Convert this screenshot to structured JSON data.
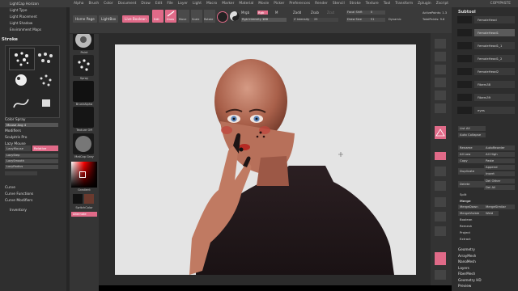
{
  "menubar": {
    "items": [
      "Alpha",
      "Brush",
      "Color",
      "Document",
      "Draw",
      "Edit",
      "File",
      "Layer",
      "Light",
      "Macro",
      "Marker",
      "Material",
      "Movie",
      "Picker",
      "Preferences",
      "Render",
      "Stencil",
      "Stroke",
      "Texture",
      "Tool",
      "Transform",
      "Zplugin",
      "Zscript"
    ],
    "left_items": [
      "LightCap Horizon",
      "Light Type",
      "Light Placement",
      "Light Shadow",
      "Environment Maps"
    ],
    "right_items": [
      "COPYPASTE"
    ]
  },
  "left_panel": {
    "section_title": "Stroke",
    "stroke_types": [
      "Spray",
      "Dots",
      "DragRect",
      "Spray",
      "Freehand",
      "Rect"
    ],
    "color_spray_label": "Color Spray",
    "mouse_avg_label": "Mouse Avg 4",
    "rows": [
      "Modifiers",
      "Sculptris Pro",
      "Lazy Mouse",
      "LazyMouse",
      "Relative",
      "Curve",
      "Curve Functions",
      "Curve Modifiers",
      "Inventory"
    ],
    "lazy_step_label": "LazyStep",
    "lazy_smooth_label": "LazySmooth",
    "lazy_radius_label": "LazyRadius"
  },
  "top_toolbar": {
    "home_page": "Home Page",
    "lightbox": "LightBox",
    "live_boolean": "Live Boolean",
    "edit": "Edit",
    "draw": "Draw",
    "move": "Move",
    "scale": "Scale",
    "rotate": "Rotate",
    "mrgb": "Mrgb",
    "rgb": "Rgb",
    "m": "M",
    "zadd": "Zadd",
    "zsub": "Zsub",
    "zcut": "Zcut",
    "rgb_intensity_label": "Rgb Intensity",
    "rgb_intensity_value": "100",
    "z_intensity_label": "Z Intensity",
    "z_intensity_value": "25",
    "focal_shift_label": "Focal Shift",
    "focal_shift_value": "0",
    "draw_size_label": "Draw Size",
    "draw_size_value": "51",
    "dynamic_label": "Dynamic",
    "active_points_label": "ActivePoints:",
    "active_points_value": "1.3",
    "total_points_label": "TotalPoints:",
    "total_points_value": "9.6"
  },
  "shelf": {
    "items": [
      "Paint",
      "Spray",
      "BrushAlpha",
      "Texture Off",
      "MatCap Gray",
      "Gradient",
      "SwitchColor",
      "Alternate"
    ]
  },
  "right_panel": {
    "title": "COPYPASTE",
    "subtool_header": "Subtool",
    "subtools": [
      "FemaleHead",
      "FemaleHead1",
      "FemaleHead1_1",
      "FemaleHead1_2",
      "FemaleHead2",
      "Fibers38",
      "Fibers39",
      "eyes"
    ],
    "list_all": "List All",
    "auto_collapse": "Auto Collapse",
    "rename": "Rename",
    "auto_reorder": "AutoReorder",
    "all_low": "All Low",
    "all_high": "All High",
    "copy": "Copy",
    "paste": "Paste",
    "append": "Append",
    "duplicate": "Duplicate",
    "insert": "Insert",
    "delete": "Delete",
    "del_other": "Del Other",
    "del_all": "Del All",
    "split": "Split",
    "merge": "Merge",
    "merge_down": "MergeDown",
    "merge_similar": "MergeSimilar",
    "merge_visible": "MergeVisible",
    "weld": "Weld",
    "boolean": "Boolean",
    "remesh": "Remesh",
    "project": "Project",
    "extract": "Extract",
    "bottom_sections": [
      "Geometry",
      "ArrayMesh",
      "NanoMesh",
      "Layers",
      "FiberMesh",
      "Geometry HD",
      "Preview"
    ]
  },
  "colors": {
    "accent": "#e06a88",
    "canvas": "#e4e4e4",
    "panel": "#2f2f2f"
  }
}
